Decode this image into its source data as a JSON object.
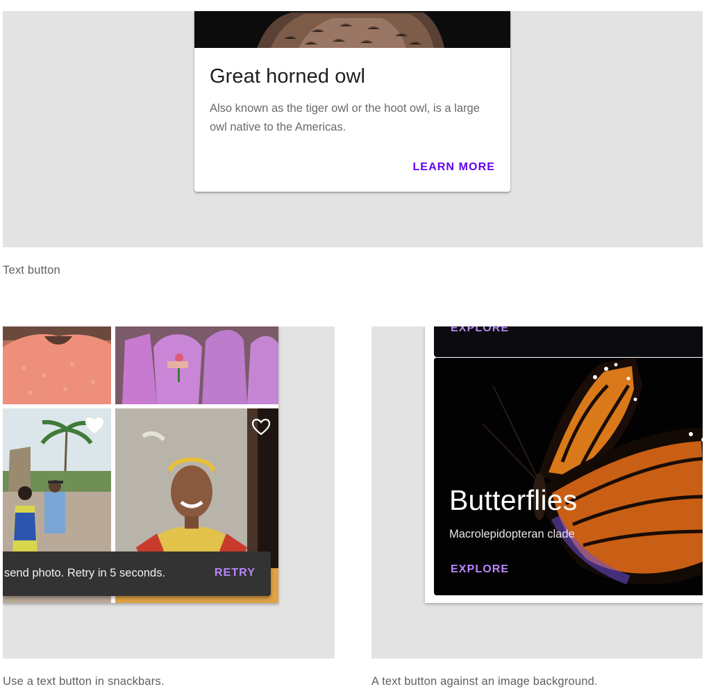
{
  "text_button_demo": {
    "card": {
      "title": "Great horned owl",
      "description": "Also known as the tiger owl or the hoot owl, is a large owl native to the Americas.",
      "action_label": "LEARN MORE"
    },
    "caption": "Text button"
  },
  "snackbar_demo": {
    "snackbar": {
      "message": "send photo. Retry in 5 seconds.",
      "action_label": "RETRY"
    },
    "caption": "Use a text button in snackbars."
  },
  "image_background_demo": {
    "previous_card_action_label": "EXPLORE",
    "card": {
      "title": "Butterflies",
      "subtitle": "Macrolepidopteran clade",
      "action_label": "EXPLORE"
    },
    "caption": "A text button against an image background."
  },
  "colors": {
    "primary": "#6200ee",
    "primary_on_dark": "#bb86fc",
    "panel_background": "#e3e3e3",
    "snackbar_surface": "#333333"
  }
}
